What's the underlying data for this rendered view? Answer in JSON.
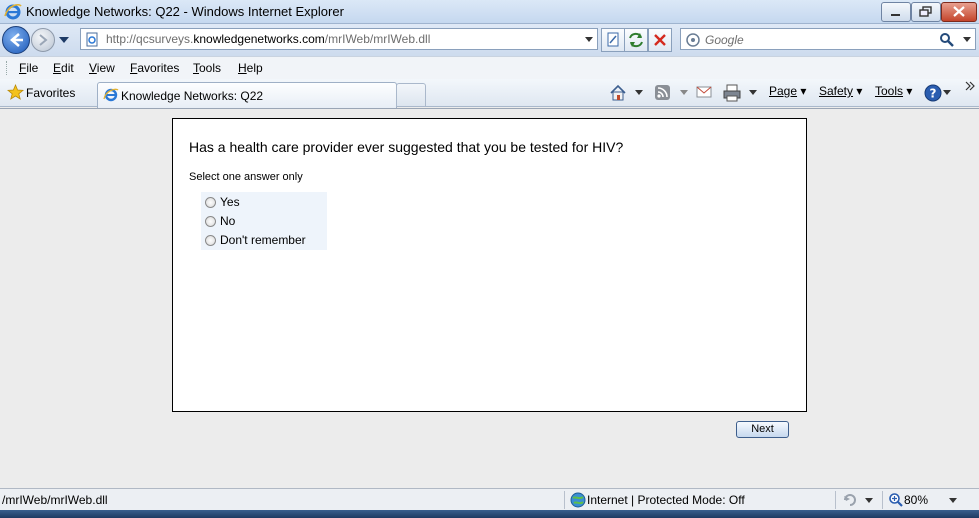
{
  "window": {
    "title": "Knowledge Networks: Q22 - Windows Internet Explorer"
  },
  "address_bar": {
    "url_prefix": "http://qcsurveys.",
    "url_domain": "knowledgenetworks.com",
    "url_suffix": "/mrIWeb/mrIWeb.dll"
  },
  "search": {
    "placeholder": "Google"
  },
  "menu": {
    "items": [
      "File",
      "Edit",
      "View",
      "Favorites",
      "Tools",
      "Help"
    ]
  },
  "favorites_bar": {
    "favorites_label": "Favorites",
    "tab_label": "Knowledge Networks: Q22"
  },
  "command_bar": {
    "page_label": "Page",
    "safety_label": "Safety",
    "tools_label": "Tools"
  },
  "survey": {
    "question": "Has a health care provider ever suggested that you be tested for HIV?",
    "instruction": "Select one answer only",
    "options": [
      "Yes",
      "No",
      "Don't remember"
    ],
    "next_label": "Next"
  },
  "status_bar": {
    "status_text": "/mrIWeb/mrIWeb.dll",
    "zone_text": "Internet | Protected Mode: Off",
    "zoom_text": "80%"
  },
  "colors": {
    "accent": "#1b58b8",
    "answer_bg": "#eef4fb"
  }
}
